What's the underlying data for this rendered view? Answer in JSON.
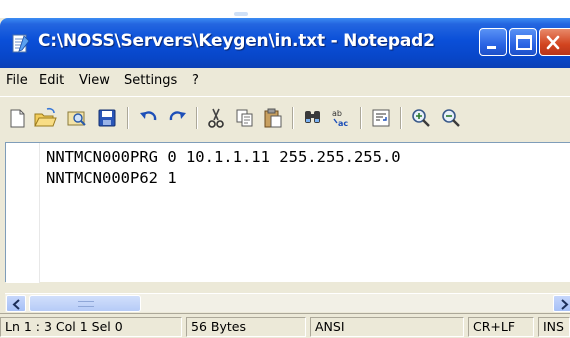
{
  "window": {
    "title": "C:\\NOSS\\Servers\\Keygen\\in.txt - Notepad2"
  },
  "menu": {
    "items": [
      "File",
      "Edit",
      "View",
      "Settings",
      "?"
    ]
  },
  "toolbar": {
    "icons": [
      "new-file-icon",
      "open-folder-icon",
      "browse-icon",
      "save-icon",
      "undo-icon",
      "redo-icon",
      "cut-icon",
      "copy-icon",
      "paste-icon",
      "find-icon",
      "replace-icon",
      "word-wrap-icon",
      "zoom-in-icon"
    ]
  },
  "editor": {
    "lines": [
      "NNTMCN000PRG 0 10.1.1.11 255.255.255.0",
      "NNTMCN000P62 1"
    ]
  },
  "statusbar": {
    "position": "Ln 1 : 3   Col 1   Sel 0",
    "size": "56 Bytes",
    "encoding": "ANSI",
    "line_endings": "CR+LF",
    "mode": "INS"
  },
  "colors": {
    "titlebar": "#0a4fd8",
    "close_button": "#d2441f",
    "window_face": "#ece9d8",
    "scrollbar": "#a6c0f7"
  }
}
